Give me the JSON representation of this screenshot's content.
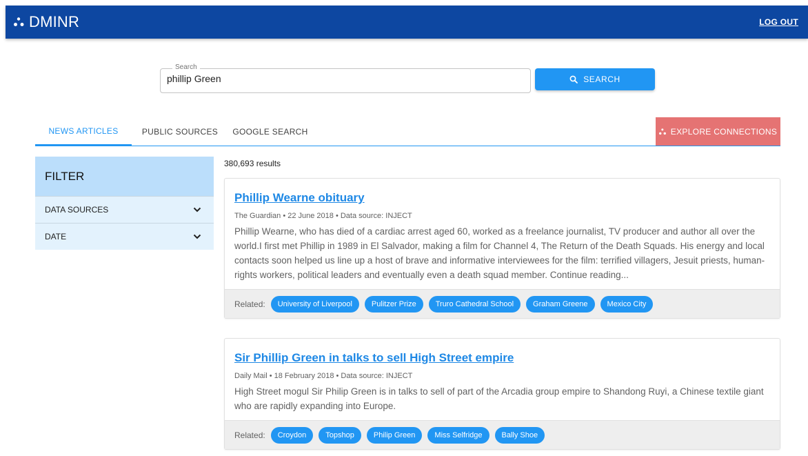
{
  "app": {
    "name": "DMINR",
    "logout_label": "LOG OUT"
  },
  "search": {
    "label": "Search",
    "value": "phillip Green",
    "button_label": "SEARCH"
  },
  "tabs": [
    {
      "label": "NEWS ARTICLES",
      "active": true
    },
    {
      "label": "PUBLIC SOURCES",
      "active": false
    },
    {
      "label": "GOOGLE SEARCH",
      "active": false
    }
  ],
  "explore": {
    "label": "EXPLORE CONNECTIONS"
  },
  "filter": {
    "title": "FILTER",
    "items": [
      {
        "label": "DATA SOURCES"
      },
      {
        "label": "DATE"
      }
    ]
  },
  "results": {
    "count_text": "380,693 results",
    "related_label": "Related:",
    "articles": [
      {
        "title": "Phillip Wearne obituary",
        "meta": "The Guardian • 22 June 2018 • Data source: INJECT",
        "snippet": "Phillip Wearne, who has died of a cardiac arrest aged 60, worked as a freelance journalist, TV producer and author all over the world.I first met Phillip in 1989 in El Salvador, making a film for Channel 4, The Return of the Death Squads. His energy and local contacts soon helped us line up a host of brave and informative interviewees for the film: terrified villagers, Jesuit priests, human-rights workers, political leaders and eventually even a death squad member. Continue reading...",
        "related": [
          "University of Liverpool",
          "Pulitzer Prize",
          "Truro Cathedral School",
          "Graham Greene",
          "Mexico City"
        ]
      },
      {
        "title": "Sir Phillip Green in talks to sell High Street empire",
        "meta": "Daily Mail • 18 February 2018 • Data source: INJECT",
        "snippet": "High Street mogul Sir Philip Green is in talks to sell of part of the Arcadia group empire to Shandong Ruyi, a Chinese textile giant who are rapidly expanding into Europe.",
        "related": [
          "Croydon",
          "Topshop",
          "Philip Green",
          "Miss Selfridge",
          "Bally Shoe"
        ]
      }
    ]
  },
  "colors": {
    "header": "#0d47a1",
    "accent": "#2196f3",
    "explore": "#e57373",
    "filter_head": "#bbdefb",
    "filter_row": "#e3f2fd"
  }
}
